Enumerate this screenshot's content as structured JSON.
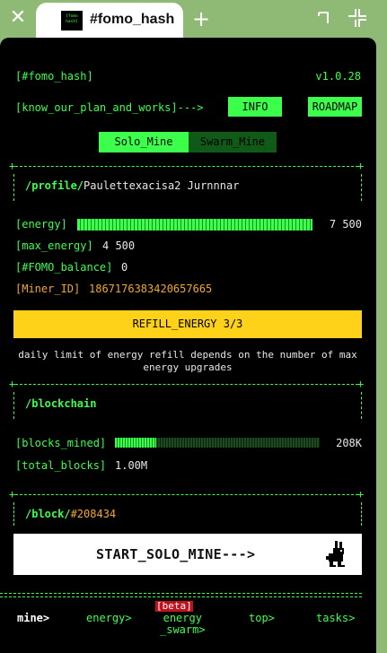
{
  "browser": {
    "tab_title": "#fomo_hash",
    "favicon_text": "[fomo\nhash]"
  },
  "header": {
    "brand": "[#fomo_hash]",
    "version": "v1.0.28"
  },
  "links": {
    "plan_text": "[know_our_plan_and_works]--->",
    "info_label": "INFO",
    "roadmap_label": "ROADMAP"
  },
  "mode_tabs": [
    {
      "label": "Solo_Mine",
      "active": true
    },
    {
      "label": "Swarm_Mine",
      "active": false
    }
  ],
  "profile": {
    "path_label": "/profile/",
    "name": "Paulettexacisa2 Jurnnnar"
  },
  "stats": {
    "energy_label": "[energy]",
    "energy_value": "7 500",
    "energy_fraction": 1.0,
    "max_energy_label": "[max_energy]",
    "max_energy_value": "4 500",
    "balance_label": "[#FOMO_balance]",
    "balance_value": "0",
    "miner_id_label": "[Miner_ID]",
    "miner_id_value": "1867176383420657665"
  },
  "refill": {
    "label": "REFILL_ENERGY 3/3",
    "note": "daily limit of energy refill depends on the number of max energy upgrades"
  },
  "blockchain": {
    "title": "/blockchain",
    "blocks_mined_label": "[blocks_mined]",
    "blocks_mined_value": "208K",
    "blocks_mined_fraction": 0.2,
    "total_blocks_label": "[total_blocks]",
    "total_blocks_value": "1.00M"
  },
  "block": {
    "path_label": "/block/",
    "number": "#208434"
  },
  "start": {
    "label": "START_SOLO_MINE--->"
  },
  "nav": {
    "mine": "mine>",
    "energy": "energy>",
    "beta_badge": "[beta]",
    "energy_swarm_line1": "energy",
    "energy_swarm_line2": "_swarm>",
    "top": "top>",
    "tasks": "tasks>"
  },
  "colors": {
    "accent": "#3cff4c",
    "gold": "#ffd21a",
    "miner_id": "#f0a828",
    "background": "#000000",
    "chrome": "#8fba76"
  }
}
